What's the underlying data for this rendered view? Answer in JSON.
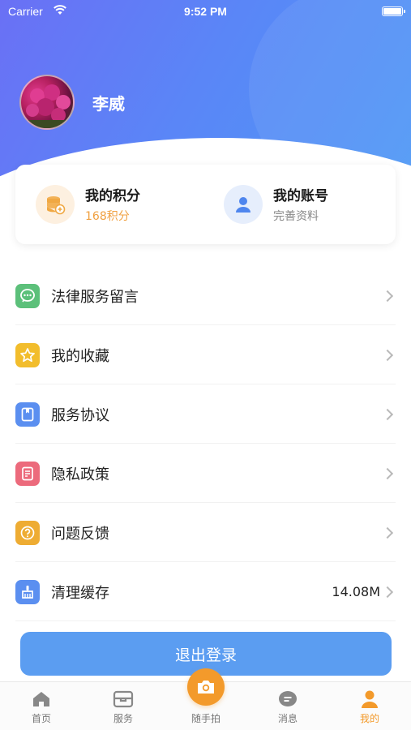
{
  "status_bar": {
    "carrier": "Carrier",
    "time": "9:52 PM"
  },
  "profile": {
    "name": "李威"
  },
  "points_card": {
    "title": "我的积分",
    "subtitle": "168积分"
  },
  "account_card": {
    "title": "我的账号",
    "subtitle": "完善资料"
  },
  "menu": {
    "items": [
      {
        "label": "法律服务留言",
        "icon": "message-icon",
        "color": "#5cc07a"
      },
      {
        "label": "我的收藏",
        "icon": "star-icon",
        "color": "#f2bd2c"
      },
      {
        "label": "服务协议",
        "icon": "book-icon",
        "color": "#5b8ff0"
      },
      {
        "label": "隐私政策",
        "icon": "document-icon",
        "color": "#ec6a7c"
      },
      {
        "label": "问题反馈",
        "icon": "question-icon",
        "color": "#eeac33"
      },
      {
        "label": "清理缓存",
        "icon": "broom-icon",
        "color": "#5b8ff0",
        "value": "14.08M"
      }
    ]
  },
  "logout": {
    "label": "退出登录"
  },
  "tabbar": {
    "items": [
      {
        "label": "首页",
        "icon": "home-icon"
      },
      {
        "label": "服务",
        "icon": "box-icon"
      },
      {
        "label": "随手拍",
        "icon": "camera-icon"
      },
      {
        "label": "消息",
        "icon": "chat-icon"
      },
      {
        "label": "我的",
        "icon": "person-icon",
        "active": true
      }
    ],
    "active_color": "#f39a2b"
  },
  "colors": {
    "header_start": "#6a70f5",
    "header_end": "#4c9af5",
    "logout_button": "#5b9df1",
    "accent": "#f39a2b"
  }
}
